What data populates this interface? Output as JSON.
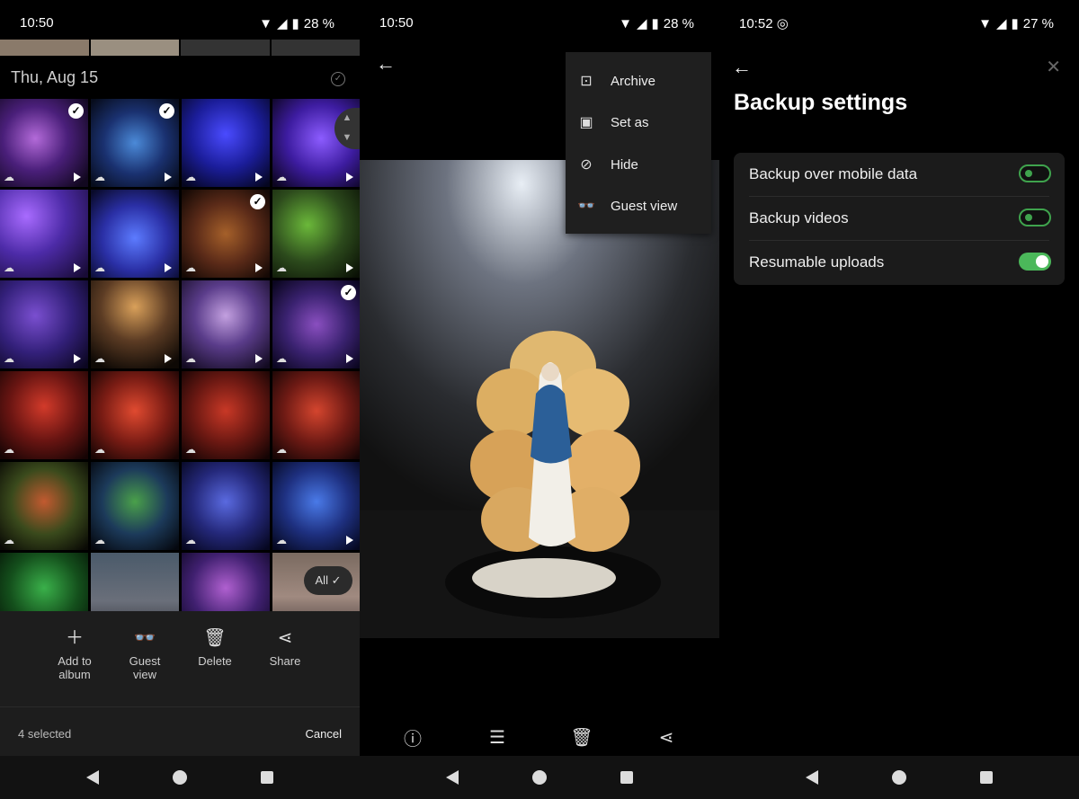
{
  "panel1": {
    "status": {
      "time": "10:50",
      "battery": "28 %"
    },
    "date_header": "Thu, Aug 15",
    "all_button": "All",
    "actions": [
      {
        "icon": "plus-icon",
        "label": "Add to album"
      },
      {
        "icon": "guest-icon",
        "label": "Guest view"
      },
      {
        "icon": "trash-icon",
        "label": "Delete"
      },
      {
        "icon": "share-icon",
        "label": "Share"
      }
    ],
    "selected_count": "4 selected",
    "cancel": "Cancel"
  },
  "panel2": {
    "status": {
      "time": "10:50",
      "battery": "28 %"
    },
    "menu": [
      {
        "icon": "archive-icon",
        "label": "Archive"
      },
      {
        "icon": "set-as-icon",
        "label": "Set as"
      },
      {
        "icon": "hide-icon",
        "label": "Hide"
      },
      {
        "icon": "guest-icon",
        "label": "Guest view"
      }
    ],
    "viewer_actions": [
      "info-icon",
      "edit-icon",
      "trash-icon",
      "share-icon"
    ]
  },
  "panel3": {
    "status": {
      "time": "10:52",
      "battery": "27 %"
    },
    "title": "Backup settings",
    "settings": [
      {
        "label": "Backup over mobile data",
        "enabled": false
      },
      {
        "label": "Backup videos",
        "enabled": false
      },
      {
        "label": "Resumable uploads",
        "enabled": true
      }
    ]
  },
  "colors": {
    "accent_green": "#4bb85a",
    "bar_bg": "#1d1d1d",
    "card_bg": "#1b1b1b"
  }
}
